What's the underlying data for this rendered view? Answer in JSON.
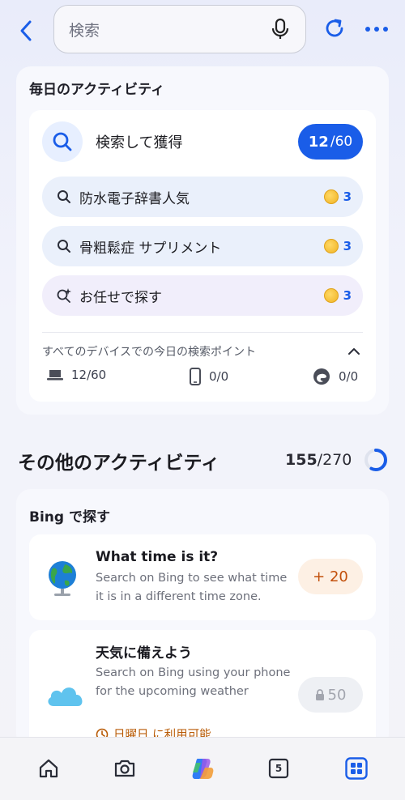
{
  "header": {
    "search_placeholder": "検索"
  },
  "daily": {
    "title": "毎日のアクティビティ",
    "search_earn": {
      "label": "検索して獲得",
      "progress_current": "12",
      "progress_total": "/60"
    },
    "queries": [
      {
        "text": "防水電子辞書人気",
        "points": "3"
      },
      {
        "text": "骨粗鬆症 サプリメント",
        "points": "3"
      },
      {
        "text": "お任せで探す",
        "points": "3"
      }
    ],
    "devices_title": "すべてのデバイスでの今日の検索ポイント",
    "devices": [
      {
        "icon": "laptop-icon",
        "value": "12/60"
      },
      {
        "icon": "phone-icon",
        "value": "0/0"
      },
      {
        "icon": "edge-icon",
        "value": "0/0"
      }
    ]
  },
  "other": {
    "title": "その他のアクティビティ",
    "count_done": "155",
    "count_total": "/270",
    "progress_fraction": 0.574
  },
  "bing_section": {
    "title": "Bing で探す",
    "tasks": [
      {
        "title": "What time is it?",
        "description": "Search on Bing to see what time it is in a different time zone.",
        "points": "+ 20"
      },
      {
        "title": "天気に備えよう",
        "description": "Search on Bing using your phone for the upcoming weather",
        "points": "50",
        "availability": "日曜日 に利用可能"
      }
    ]
  },
  "bottom_nav": {
    "tabs_badge": "5"
  },
  "colors": {
    "accent_blue": "#1a5de8",
    "orange": "#c24f0a",
    "coin_gold": "#f0b323"
  }
}
